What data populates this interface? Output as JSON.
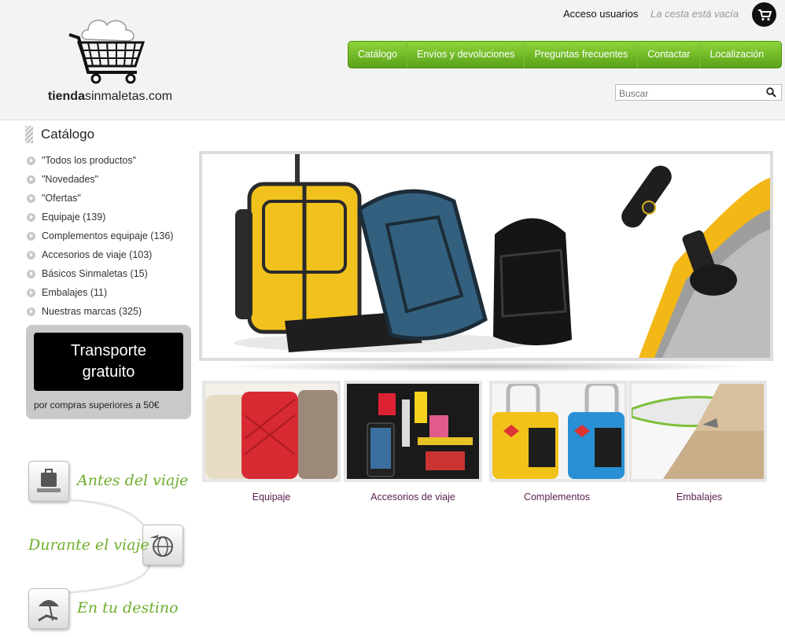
{
  "header": {
    "logo_text_bold": "tienda",
    "logo_text_rest": "sinmaletas.com",
    "user_link": "Acceso usuarios",
    "cart_status": "La cesta está vacía",
    "search_placeholder": "Buscar"
  },
  "nav": {
    "items": [
      {
        "label": "Catálogo"
      },
      {
        "label": "Envíos y devoluciones"
      },
      {
        "label": "Preguntas frecuentes"
      },
      {
        "label": "Contactar"
      },
      {
        "label": "Localización"
      }
    ]
  },
  "sidebar": {
    "title": "Catálogo",
    "items": [
      {
        "label": "\"Todos los productos\""
      },
      {
        "label": "\"Novedades\""
      },
      {
        "label": "\"Ofertas\""
      },
      {
        "label": "Equipaje (139)"
      },
      {
        "label": "Complementos equipaje (136)"
      },
      {
        "label": "Accesorios de viaje (103)"
      },
      {
        "label": "Básicos Sinmaletas (15)"
      },
      {
        "label": "Embalajes (11)"
      },
      {
        "label": "Nuestras marcas (325)"
      }
    ]
  },
  "promo": {
    "title_line1": "Transporte",
    "title_line2": "gratuito",
    "subtitle": "por compras superiores a 50€"
  },
  "journey": {
    "before": "Antes del viaje",
    "during": "Durante el viaje",
    "destination": "En tu destino"
  },
  "categories": [
    {
      "label": "Equipaje"
    },
    {
      "label": "Accesorios de viaje"
    },
    {
      "label": "Complementos"
    },
    {
      "label": "Embalajes"
    }
  ]
}
